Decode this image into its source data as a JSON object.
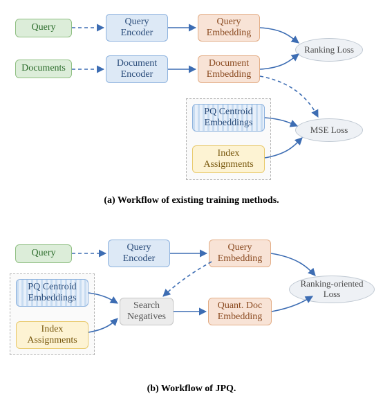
{
  "chart_data": [
    {
      "type": "diagram",
      "title": "(a) Workflow of existing training methods.",
      "nodes": [
        {
          "id": "query-a",
          "label": "Query",
          "kind": "input"
        },
        {
          "id": "docs-a",
          "label": "Documents",
          "kind": "input"
        },
        {
          "id": "q-enc-a",
          "label": "Query Encoder",
          "kind": "encoder"
        },
        {
          "id": "d-enc-a",
          "label": "Document Encoder",
          "kind": "encoder"
        },
        {
          "id": "q-emb-a",
          "label": "Query Embedding",
          "kind": "embedding"
        },
        {
          "id": "d-emb-a",
          "label": "Document Embedding",
          "kind": "embedding"
        },
        {
          "id": "pq-a",
          "label": "PQ Centroid Embeddings",
          "kind": "pq"
        },
        {
          "id": "idx-a",
          "label": "Index Assignments",
          "kind": "index"
        },
        {
          "id": "rank-a",
          "label": "Ranking Loss",
          "kind": "loss"
        },
        {
          "id": "mse-a",
          "label": "MSE Loss",
          "kind": "loss"
        }
      ],
      "edges": [
        {
          "from": "query-a",
          "to": "q-enc-a",
          "style": "dashed"
        },
        {
          "from": "docs-a",
          "to": "d-enc-a",
          "style": "dashed"
        },
        {
          "from": "q-enc-a",
          "to": "q-emb-a",
          "style": "solid"
        },
        {
          "from": "d-enc-a",
          "to": "d-emb-a",
          "style": "solid"
        },
        {
          "from": "q-emb-a",
          "to": "rank-a",
          "style": "solid"
        },
        {
          "from": "d-emb-a",
          "to": "rank-a",
          "style": "solid"
        },
        {
          "from": "d-emb-a",
          "to": "mse-a",
          "style": "dashed"
        },
        {
          "from": "pq-a",
          "to": "mse-a",
          "style": "solid"
        },
        {
          "from": "idx-a",
          "to": "mse-a",
          "style": "solid"
        }
      ]
    },
    {
      "type": "diagram",
      "title": "(b) Workflow of JPQ.",
      "nodes": [
        {
          "id": "query-b",
          "label": "Query",
          "kind": "input"
        },
        {
          "id": "q-enc-b",
          "label": "Query Encoder",
          "kind": "encoder"
        },
        {
          "id": "q-emb-b",
          "label": "Query Embedding",
          "kind": "embedding"
        },
        {
          "id": "pq-b",
          "label": "PQ Centroid Embeddings",
          "kind": "pq"
        },
        {
          "id": "idx-b",
          "label": "Index Assignments",
          "kind": "index"
        },
        {
          "id": "neg-b",
          "label": "Search Negatives",
          "kind": "op"
        },
        {
          "id": "qd-emb-b",
          "label": "Quant. Doc Embedding",
          "kind": "embedding"
        },
        {
          "id": "roloss-b",
          "label": "Ranking-oriented Loss",
          "kind": "loss"
        }
      ],
      "edges": [
        {
          "from": "query-b",
          "to": "q-enc-b",
          "style": "dashed"
        },
        {
          "from": "q-enc-b",
          "to": "q-emb-b",
          "style": "solid"
        },
        {
          "from": "q-emb-b",
          "to": "neg-b",
          "style": "dashed"
        },
        {
          "from": "pq-b",
          "to": "neg-b",
          "style": "solid"
        },
        {
          "from": "idx-b",
          "to": "neg-b",
          "style": "solid"
        },
        {
          "from": "neg-b",
          "to": "qd-emb-b",
          "style": "solid"
        },
        {
          "from": "q-emb-b",
          "to": "roloss-b",
          "style": "solid"
        },
        {
          "from": "qd-emb-b",
          "to": "roloss-b",
          "style": "solid"
        }
      ]
    }
  ],
  "a": {
    "query": "Query",
    "documents": "Documents",
    "q_enc_l1": "Query",
    "q_enc_l2": "Encoder",
    "d_enc_l1": "Document",
    "d_enc_l2": "Encoder",
    "q_emb_l1": "Query",
    "q_emb_l2": "Embedding",
    "d_emb_l1": "Document",
    "d_emb_l2": "Embedding",
    "pq_l1": "PQ Centroid",
    "pq_l2": "Embeddings",
    "idx_l1": "Index",
    "idx_l2": "Assignments",
    "rank_loss": "Ranking Loss",
    "mse_loss": "MSE Loss",
    "caption": "(a) Workflow of existing training methods."
  },
  "b": {
    "query": "Query",
    "q_enc_l1": "Query",
    "q_enc_l2": "Encoder",
    "q_emb_l1": "Query",
    "q_emb_l2": "Embedding",
    "pq_l1": "PQ Centroid",
    "pq_l2": "Embeddings",
    "idx_l1": "Index",
    "idx_l2": "Assignments",
    "neg_l1": "Search",
    "neg_l2": "Negatives",
    "qd_emb_l1": "Quant. Doc",
    "qd_emb_l2": "Embedding",
    "ro_loss_l1": "Ranking-oriented",
    "ro_loss_l2": "Loss",
    "caption": "(b) Workflow of JPQ."
  }
}
